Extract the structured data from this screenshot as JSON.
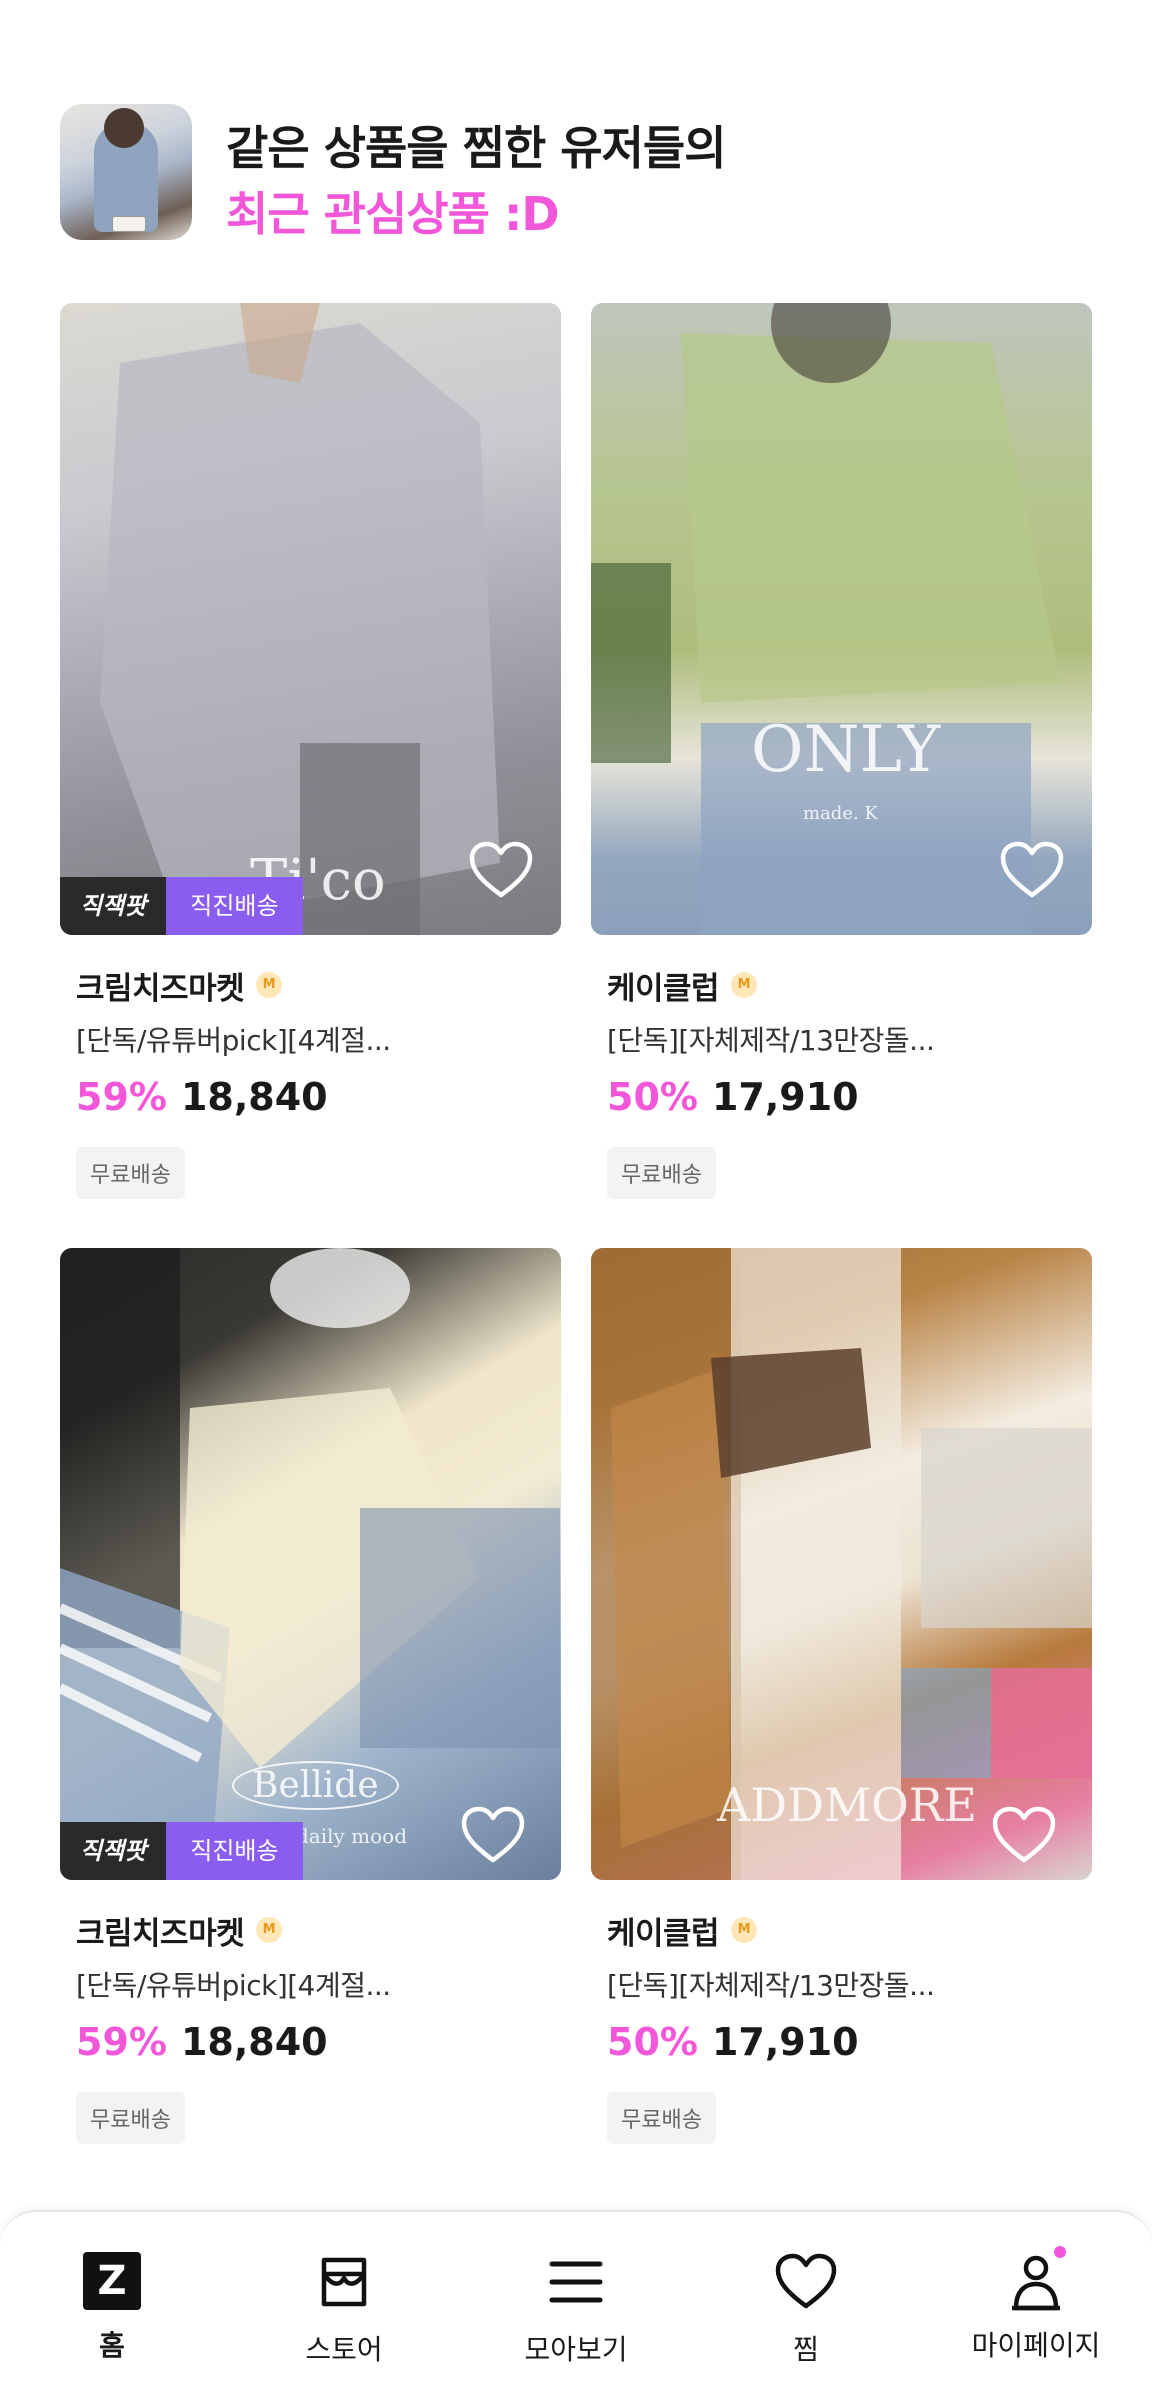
{
  "header": {
    "line1": "같은 상품을 찜한 유저들의",
    "line2": "최근 관심상품 :D"
  },
  "products": [
    {
      "store": "크림치즈마켓",
      "grade": "M",
      "title": "[단독/유튜버pick][4계절...",
      "discount": "59%",
      "price": "18,840",
      "shipping": "무료배송",
      "badge_zik": "직잭팟",
      "badge_direct": "직진배송",
      "watermark": "Ti'co"
    },
    {
      "store": "케이클럽",
      "grade": "M",
      "title": "[단독][자체제작/13만장돌...",
      "discount": "50%",
      "price": "17,910",
      "shipping": "무료배송",
      "watermark": "ONLY",
      "watermark_sub": "made. K"
    },
    {
      "store": "크림치즈마켓",
      "grade": "M",
      "title": "[단독/유튜버pick][4계절...",
      "discount": "59%",
      "price": "18,840",
      "shipping": "무료배송",
      "badge_zik": "직잭팟",
      "badge_direct": "직진배송",
      "watermark": "Bellide",
      "watermark_sub": "daily mood"
    },
    {
      "store": "케이클럽",
      "grade": "M",
      "title": "[단독][자체제작/13만장돌...",
      "discount": "50%",
      "price": "17,910",
      "shipping": "무료배송",
      "watermark": "ADDMORE"
    }
  ],
  "tabbar": {
    "home": "홈",
    "home_icon_letter": "Z",
    "store": "스토어",
    "browse": "모아보기",
    "wishlist": "찜",
    "mypage": "마이페이지"
  },
  "colors": {
    "accent_pink": "#f157d8",
    "direct_purple": "#8a5cf0"
  }
}
